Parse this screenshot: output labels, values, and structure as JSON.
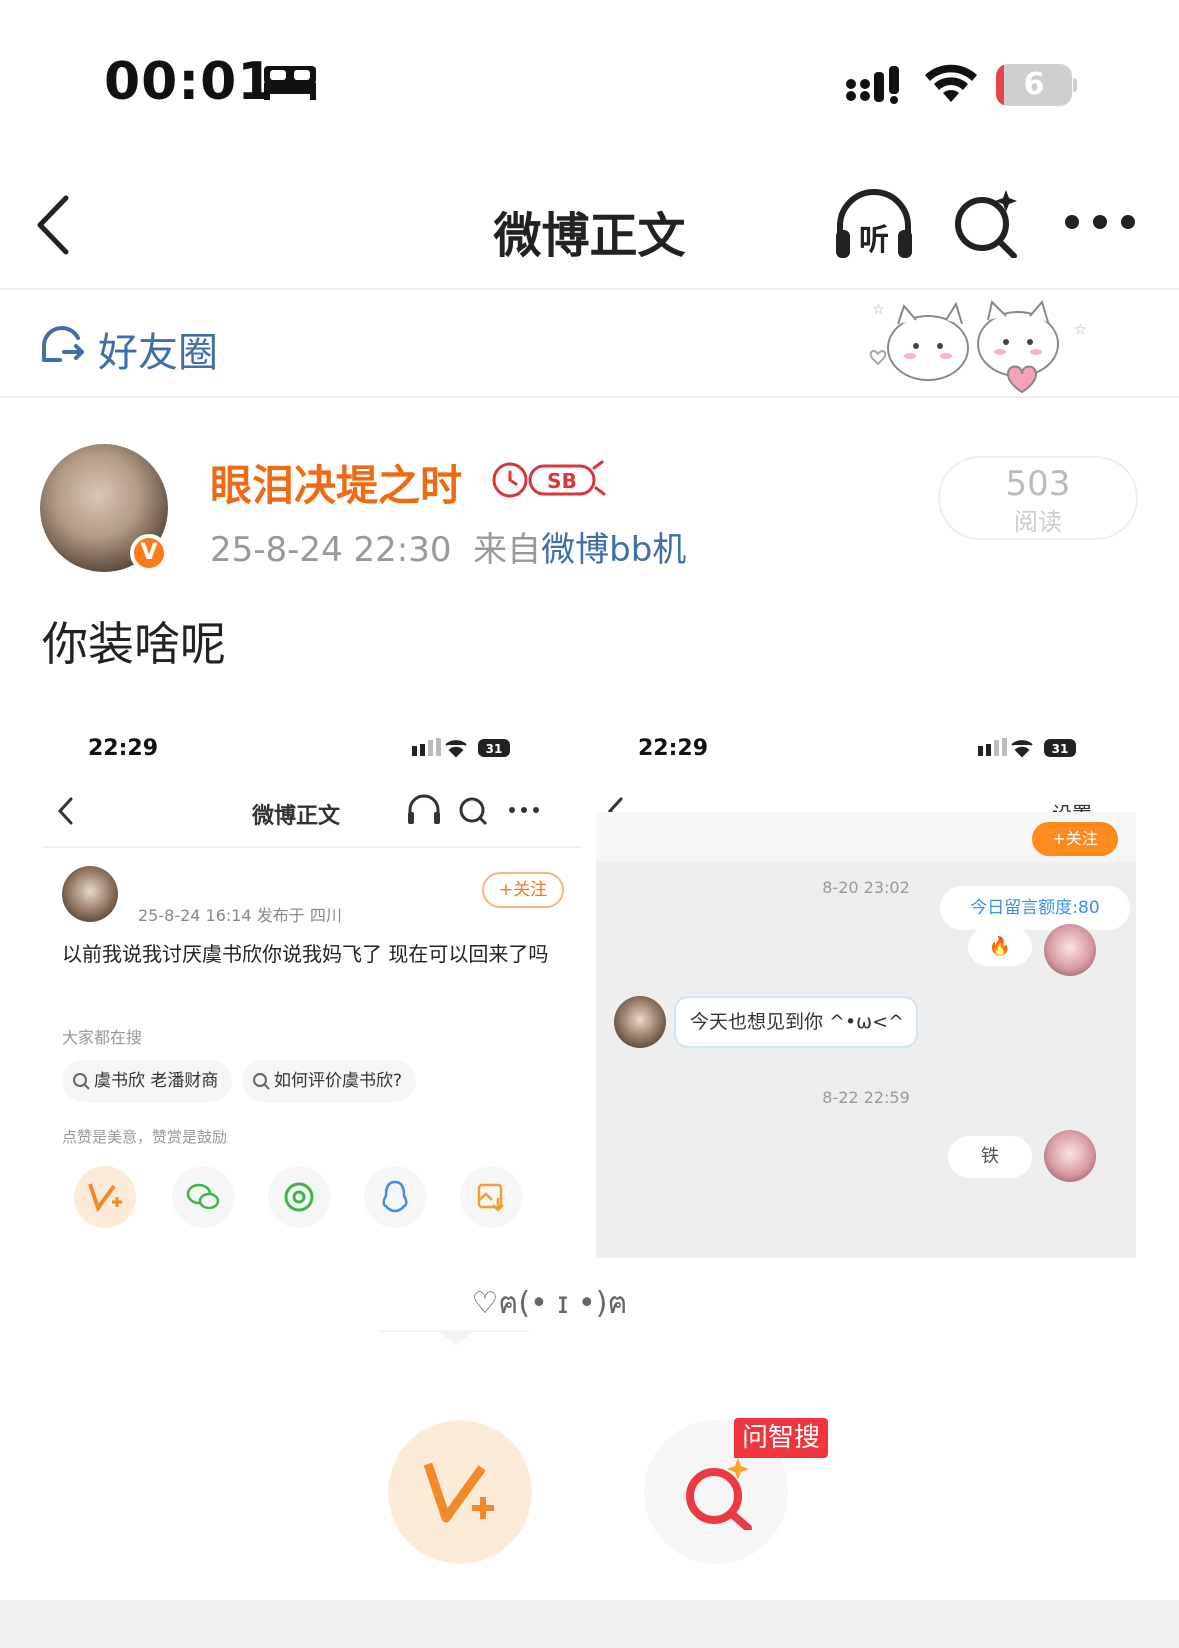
{
  "status_bar": {
    "time": "00:01",
    "battery_level": "6",
    "battery_fraction": 0.06,
    "icons": [
      "sleep-bed-icon",
      "signal-icon",
      "wifi-icon",
      "battery-icon"
    ]
  },
  "nav": {
    "title": "微博正文",
    "listen_label": "听",
    "icons": [
      "back-chevron-icon",
      "listen-headphones-icon",
      "smart-search-icon",
      "more-dots-icon"
    ]
  },
  "friend_circle": {
    "label": "好友圈",
    "icon": "friend-circle-icon"
  },
  "post": {
    "username": "眼泪决堤之时",
    "user_badge": "SB",
    "date": "25-8-24 22:30",
    "source_prefix": "来自",
    "source": "微博bb机",
    "verified_mark": "V",
    "reads_count": "503",
    "reads_label": "阅读",
    "text": "你装啥呢"
  },
  "embedded_left": {
    "time": "22:29",
    "battery": "31",
    "title": "微博正文",
    "follow": "+关注",
    "meta": "25-8-24 16:14  发布于 四川",
    "text": "以前我说我讨厌虞书欣你说我妈飞了 现在可以回来了吗",
    "search_label": "大家都在搜",
    "chips": [
      "虞书欣 老潘财商",
      "如何评价虞书欣?"
    ],
    "praise_label": "点赞是美意，赞赏是鼓励",
    "share_icons": [
      "reward-v-icon",
      "wechat-icon",
      "moments-icon",
      "qq-icon",
      "save-image-icon"
    ]
  },
  "embedded_right": {
    "time": "22:29",
    "battery": "31",
    "title": "设置",
    "follow": "+关注",
    "time1": "8-20 23:02",
    "quota": "今日留言额度:80",
    "bubble_mine": "🔥",
    "bubble_other": "今天也想见到你 ^•ω<^",
    "time2": "8-22 22:59",
    "bubble_iron": "铁"
  },
  "bottom": {
    "kaomoji": "♡ฅ(• ɪ •)ฅ",
    "reward_icon": "reward-v-icon",
    "smart_search_tag": "问智搜",
    "smart_search_icon": "smart-search-icon"
  },
  "colors": {
    "accent_orange": "#f06a14",
    "link_blue": "#3f6fa6",
    "badge_red": "#f0353d",
    "battery_red": "#e8434a"
  }
}
